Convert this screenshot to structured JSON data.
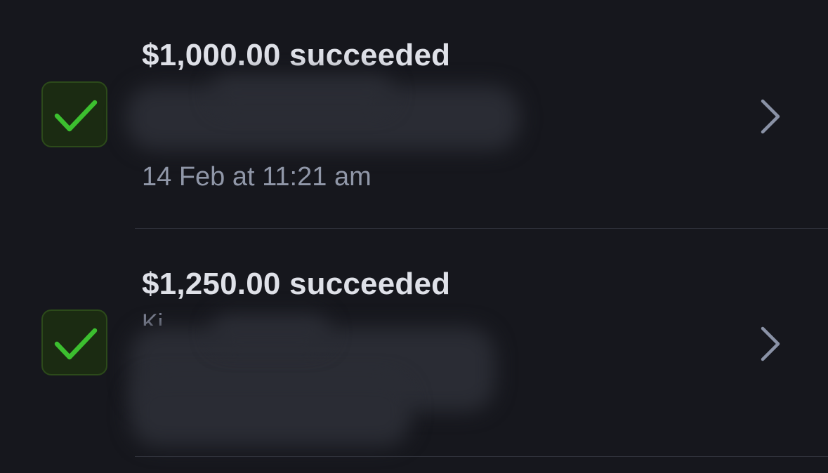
{
  "colors": {
    "background": "#16171d",
    "title_text": "#dfe1e8",
    "secondary_text": "#9097a8",
    "check_green": "#3cbf2f",
    "check_bg": "#1b2b12",
    "chevron": "#8a92a6",
    "divider": "#2f313a"
  },
  "transactions": [
    {
      "title": "$1,000.00 succeeded",
      "timestamp": "14 Feb at 11:21 am",
      "status_icon": "checkmark-icon",
      "nav_icon": "chevron-right-icon"
    },
    {
      "title": "$1,250.00 succeeded",
      "partial_text": "Ki",
      "status_icon": "checkmark-icon",
      "nav_icon": "chevron-right-icon"
    }
  ]
}
